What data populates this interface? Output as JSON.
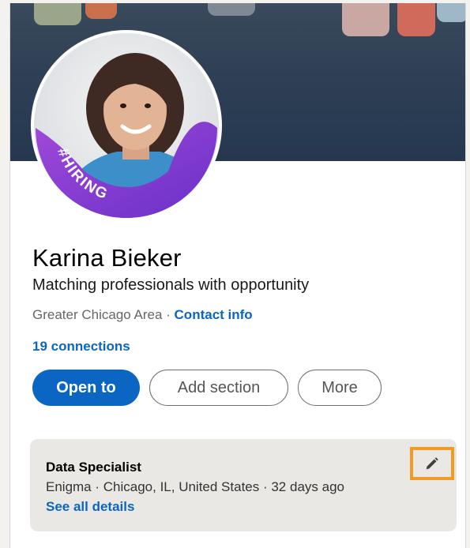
{
  "profile": {
    "name": "Karina Bieker",
    "headline": "Matching professionals with opportunity",
    "location": "Greater Chicago Area",
    "location_separator": " · ",
    "contact_info_label": "Contact info",
    "connections_label": "19 connections",
    "hiring_badge": "#HIRING"
  },
  "actions": {
    "open_to_label": "Open to",
    "add_section_label": "Add section",
    "more_label": "More"
  },
  "job": {
    "title": "Data Specialist",
    "details": "Enigma · Chicago, IL, United States · 32 days ago",
    "see_all_label": "See all details",
    "edit_icon": "pencil-icon"
  },
  "colors": {
    "brand_blue": "#0a66c2",
    "hiring_purple": "#7a3ad6",
    "highlight_orange": "#f29b20"
  }
}
